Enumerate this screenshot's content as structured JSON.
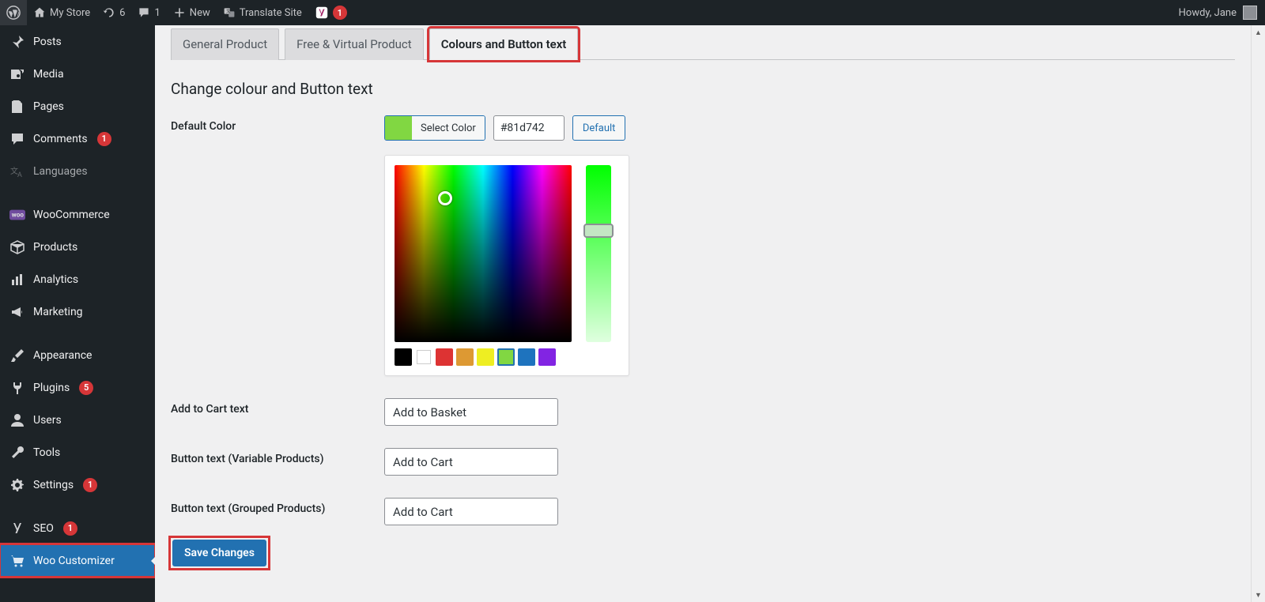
{
  "adminbar": {
    "site_name": "My Store",
    "updates": "6",
    "comments": "1",
    "new": "New",
    "translate": "Translate Site",
    "yoast_badge": "1",
    "greeting": "Howdy, Jane"
  },
  "sidebar": {
    "items": [
      {
        "id": "posts",
        "icon": "pin",
        "label": "Posts"
      },
      {
        "id": "media",
        "icon": "media",
        "label": "Media"
      },
      {
        "id": "pages",
        "icon": "page",
        "label": "Pages"
      },
      {
        "id": "comments",
        "icon": "comment",
        "label": "Comments",
        "badge": "1"
      },
      {
        "id": "languages",
        "icon": "lang",
        "label": "Languages",
        "dim": true
      },
      {
        "sep": true
      },
      {
        "id": "woocommerce",
        "icon": "woo",
        "label": "WooCommerce"
      },
      {
        "id": "products",
        "icon": "box",
        "label": "Products"
      },
      {
        "id": "analytics",
        "icon": "chart",
        "label": "Analytics"
      },
      {
        "id": "marketing",
        "icon": "horn",
        "label": "Marketing"
      },
      {
        "sep": true
      },
      {
        "id": "appearance",
        "icon": "brush",
        "label": "Appearance"
      },
      {
        "id": "plugins",
        "icon": "plug",
        "label": "Plugins",
        "badge": "5"
      },
      {
        "id": "users",
        "icon": "user",
        "label": "Users"
      },
      {
        "id": "tools",
        "icon": "wrench",
        "label": "Tools"
      },
      {
        "id": "settings",
        "icon": "cog",
        "label": "Settings",
        "badge": "1"
      },
      {
        "sep": true
      },
      {
        "id": "seo",
        "icon": "yoast",
        "label": "SEO",
        "badge": "1"
      },
      {
        "id": "woo-custom",
        "icon": "cart",
        "label": "Woo Customizer",
        "current": true,
        "highlight": true
      }
    ]
  },
  "tabs": [
    {
      "id": "general",
      "label": "General Product"
    },
    {
      "id": "virtual",
      "label": "Free & Virtual Product"
    },
    {
      "id": "colours",
      "label": "Colours and Button text",
      "active": true,
      "highlight": true
    }
  ],
  "heading": "Change colour and Button text",
  "form": {
    "default_color_label": "Default Color",
    "select_color_btn": "Select Color",
    "hex_value": "#81d742",
    "default_btn": "Default",
    "palette": [
      "#000000",
      "#ffffff",
      "#dd3333",
      "#dd9933",
      "#eeee22",
      "#81d742",
      "#1e73be",
      "#8224e3"
    ],
    "palette_selected": 5,
    "add_to_cart_label": "Add to Cart text",
    "add_to_cart_value": "Add to Basket",
    "variable_label": "Button text (Variable Products)",
    "variable_value": "Add to Cart",
    "grouped_label": "Button text (Grouped Products)",
    "grouped_value": "Add to Cart"
  },
  "save_label": "Save Changes"
}
